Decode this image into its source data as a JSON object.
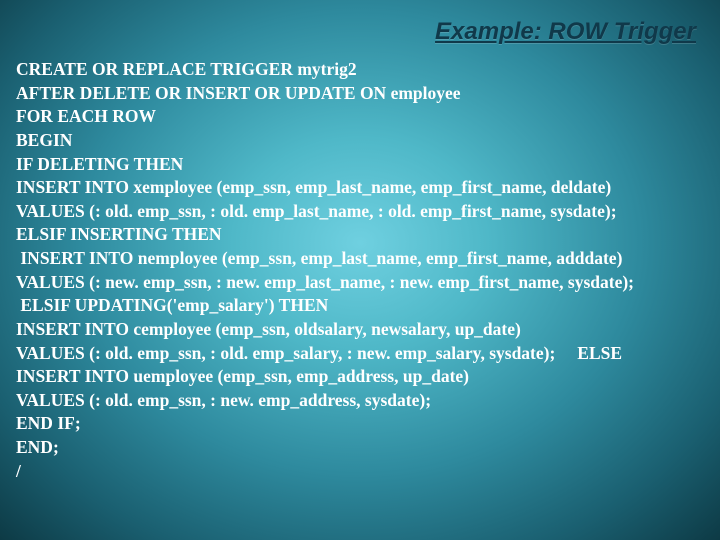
{
  "title": "Example: ROW Trigger",
  "code": {
    "l1": "CREATE OR REPLACE TRIGGER mytrig2",
    "l2": "AFTER DELETE OR INSERT OR UPDATE ON employee",
    "l3": "FOR EACH ROW",
    "l4": "BEGIN",
    "l5": "IF DELETING THEN",
    "l6": "INSERT INTO xemployee (emp_ssn, emp_last_name, emp_first_name, deldate)",
    "l7": "VALUES (: old. emp_ssn, : old. emp_last_name, : old. emp_first_name, sysdate);",
    "l8": "ELSIF INSERTING THEN",
    "l9": " INSERT INTO nemployee (emp_ssn, emp_last_name, emp_first_name, adddate)",
    "l10": "VALUES (: new. emp_ssn, : new. emp_last_name, : new. emp_first_name, sysdate);",
    "l11": " ELSIF UPDATING('emp_salary') THEN",
    "l12": "INSERT INTO cemployee (emp_ssn, oldsalary, newsalary, up_date)",
    "l13a": "VALUES (: old. emp_ssn, : old. emp_salary, : new. emp_salary, sysdate);",
    "l13b": "ELSE",
    "l14": "INSERT INTO uemployee (emp_ssn, emp_address, up_date)",
    "l15": "VALUES (: old. emp_ssn, : new. emp_address, sysdate);",
    "l16": "END IF;",
    "l17": "END;",
    "l18": "/"
  }
}
